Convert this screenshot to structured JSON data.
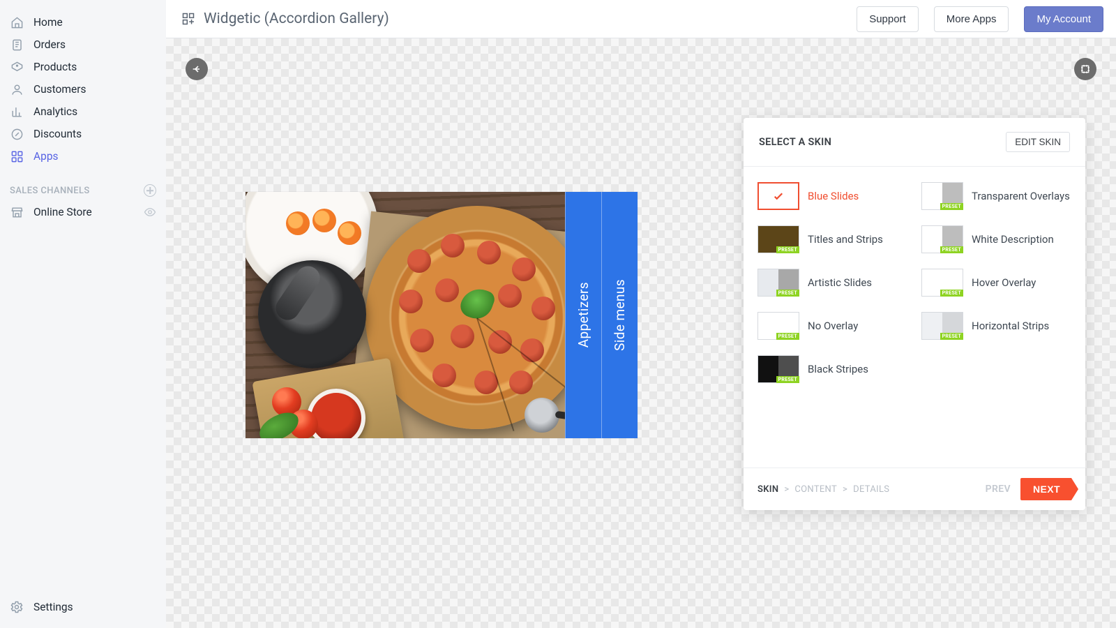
{
  "sidebar": {
    "items": [
      {
        "label": "Home"
      },
      {
        "label": "Orders"
      },
      {
        "label": "Products"
      },
      {
        "label": "Customers"
      },
      {
        "label": "Analytics"
      },
      {
        "label": "Discounts"
      },
      {
        "label": "Apps"
      }
    ],
    "channels_heading": "SALES CHANNELS",
    "channels": [
      {
        "label": "Online Store"
      }
    ],
    "settings_label": "Settings"
  },
  "topbar": {
    "title": "Widgetic (Accordion Gallery)",
    "support": "Support",
    "more_apps": "More Apps",
    "my_account": "My Account"
  },
  "gallery": {
    "strip1": "Appetizers",
    "strip2": "Side menus"
  },
  "panel": {
    "heading": "SELECT A SKIN",
    "edit_skin": "EDIT SKIN",
    "preset_tag": "PRESET",
    "skins": [
      {
        "label": "Blue Slides",
        "selected": true,
        "half": "",
        "preset": false
      },
      {
        "label": "Transparent Overlays",
        "half": "#bdbdbd",
        "preset": true
      },
      {
        "label": "Titles and Strips",
        "half": "#5c4518",
        "preset": true,
        "left_fill": "#5c4518"
      },
      {
        "label": "White Description",
        "half": "#bdbdbd",
        "preset": true
      },
      {
        "label": "Artistic Slides",
        "half": "#a8a8a8",
        "preset": true,
        "base": "#e7eaee"
      },
      {
        "label": "Hover Overlay",
        "half": "",
        "preset": true
      },
      {
        "label": "No Overlay",
        "half": "",
        "preset": true
      },
      {
        "label": "Horizontal Strips",
        "half": "#d5d7da",
        "preset": true,
        "base": "#eef0f3"
      },
      {
        "label": "Black Stripes",
        "half": "#4e4e4e",
        "preset": true,
        "left_fill": "#111"
      }
    ],
    "crumbs": {
      "c1": "SKIN",
      "c2": "CONTENT",
      "c3": "DETAILS",
      "sep": ">"
    },
    "prev": "PREV",
    "next": "NEXT"
  }
}
